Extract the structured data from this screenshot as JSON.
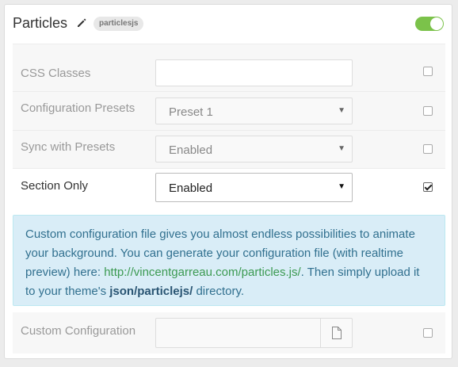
{
  "header": {
    "title": "Particles",
    "tag": "particlesjs",
    "toggle_on": true,
    "accent": "#7bc24a"
  },
  "rows": {
    "css_classes": {
      "label": "CSS Classes",
      "value": "",
      "override": false
    },
    "config_presets": {
      "label": "Configuration Presets",
      "value": "Preset 1",
      "override": false
    },
    "sync_presets": {
      "label": "Sync with Presets",
      "value": "Enabled",
      "override": false
    },
    "section_only": {
      "label": "Section Only",
      "value": "Enabled",
      "override": true
    },
    "custom_config": {
      "label": "Custom Configuration",
      "value": "",
      "override": false
    }
  },
  "info": {
    "text1": "Custom configuration file gives you almost endless possibilities to animate your background. You can generate your configuration file (with realtime preview) here: ",
    "link": "http://vincentgarreau.com/particles.js/",
    "text2": ". Then simply upload it to your theme's ",
    "path": "json/particlejs/",
    "text3": " directory."
  }
}
